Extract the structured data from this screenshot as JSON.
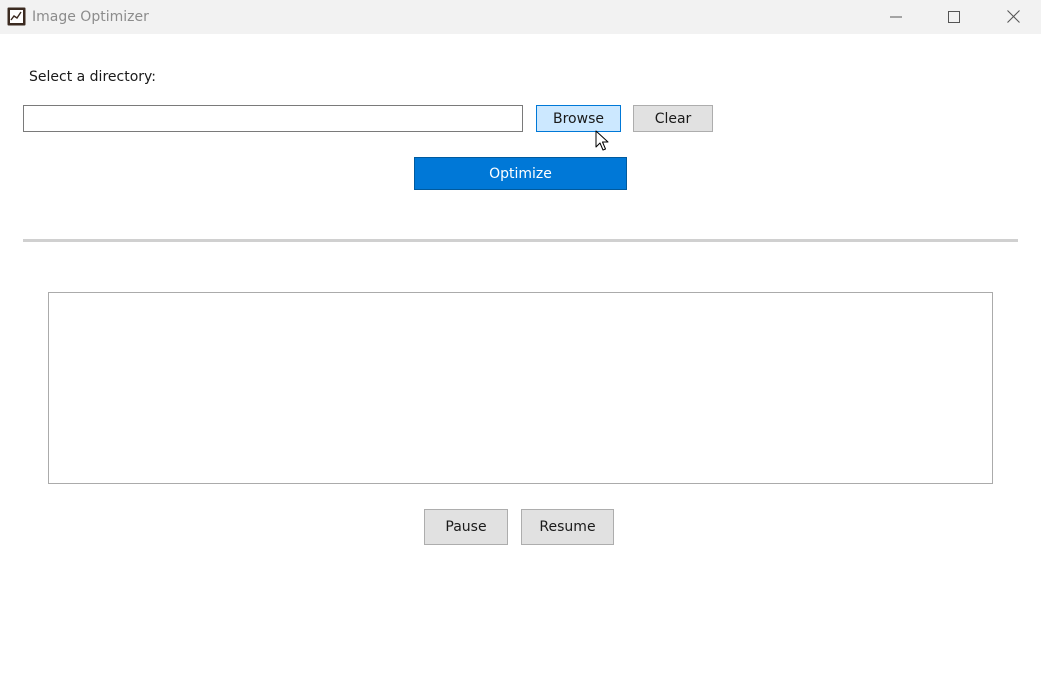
{
  "window": {
    "title": "Image Optimizer",
    "icons": {
      "app": "app-image-icon",
      "minimize": "minimize-icon",
      "maximize": "maximize-icon",
      "close": "close-icon"
    }
  },
  "directory": {
    "label": "Select a directory:",
    "value": "",
    "placeholder": ""
  },
  "buttons": {
    "browse": "Browse",
    "clear": "Clear",
    "optimize": "Optimize",
    "pause": "Pause",
    "resume": "Resume"
  },
  "log": {
    "text": ""
  },
  "colors": {
    "accent": "#0078d7",
    "hover": "#cce8ff",
    "button_gray": "#e1e1e1",
    "titlebar": "#f2f2f2"
  }
}
